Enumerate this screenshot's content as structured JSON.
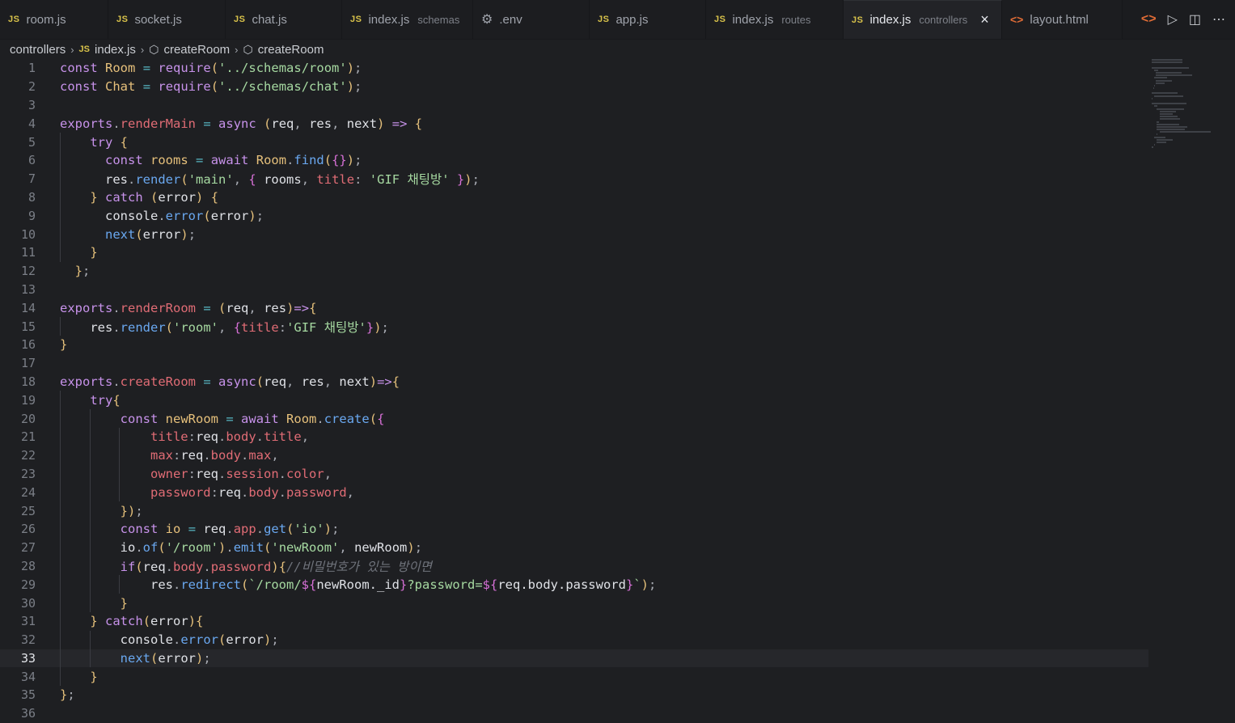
{
  "tabs": [
    {
      "label": "room.js",
      "desc": "",
      "type": "js"
    },
    {
      "label": "socket.js",
      "desc": "",
      "type": "js"
    },
    {
      "label": "chat.js",
      "desc": "",
      "type": "js"
    },
    {
      "label": "index.js",
      "desc": "schemas",
      "type": "js"
    },
    {
      "label": ".env",
      "desc": "",
      "type": "gear"
    },
    {
      "label": "app.js",
      "desc": "",
      "type": "js"
    },
    {
      "label": "index.js",
      "desc": "routes",
      "type": "js"
    },
    {
      "label": "index.js",
      "desc": "controllers",
      "type": "js",
      "active": true
    },
    {
      "label": "layout.html",
      "desc": "",
      "type": "html"
    }
  ],
  "tab_icons": {
    "js": "JS",
    "html": "<>",
    "close": "×"
  },
  "breadcrumb": {
    "folder": "controllers",
    "file": "index.js",
    "symbol1": "createRoom",
    "symbol2": "createRoom"
  },
  "editor": {
    "current_line": 33,
    "lines": [
      "const Room = require('../schemas/room');",
      "const Chat = require('../schemas/chat');",
      "",
      "exports.renderMain = async (req, res, next) => {",
      "    try {",
      "      const rooms = await Room.find({});",
      "      res.render('main', { rooms, title: 'GIF 채팅방' });",
      "    } catch (error) {",
      "      console.error(error);",
      "      next(error);",
      "    }",
      "  };",
      "",
      "exports.renderRoom = (req, res)=>{",
      "    res.render('room', {title:'GIF 채팅방'});",
      "}",
      "",
      "exports.createRoom = async(req, res, next)=>{",
      "    try{",
      "        const newRoom = await Room.create({",
      "            title:req.body.title,",
      "            max:req.body.max,",
      "            owner:req.session.color,",
      "            password:req.body.password,",
      "        });",
      "        const io = req.app.get('io');",
      "        io.of('/room').emit('newRoom', newRoom);",
      "        if(req.body.password){//비밀번호가 있는 방이면",
      "            res.redirect(`/room/${newRoom._id}?password=${req.body.password}`);",
      "        }",
      "    } catch(error){",
      "        console.error(error);",
      "        next(error);",
      "    }",
      "};",
      ""
    ]
  }
}
